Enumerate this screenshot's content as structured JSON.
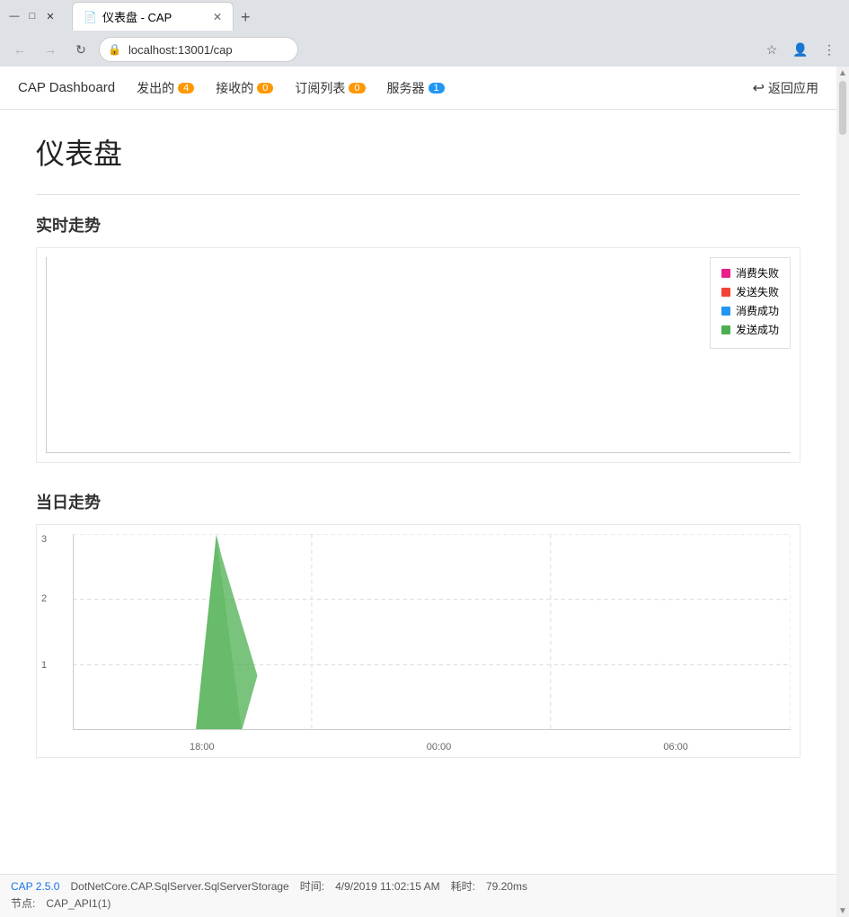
{
  "browser": {
    "tab_title": "仪表盘 - CAP",
    "tab_icon": "📄",
    "url": "localhost:13001/cap",
    "new_tab_symbol": "+",
    "nav": {
      "back_disabled": false,
      "forward_disabled": false
    }
  },
  "nav": {
    "brand": "CAP Dashboard",
    "links": [
      {
        "label": "发出的",
        "badge": "4",
        "badge_color": "orange"
      },
      {
        "label": "接收的",
        "badge": "0",
        "badge_color": "orange"
      },
      {
        "label": "订阅列表",
        "badge": "0",
        "badge_color": "orange"
      },
      {
        "label": "服务器",
        "badge": "1",
        "badge_color": "blue"
      }
    ],
    "return_label": "返回应用"
  },
  "page": {
    "title": "仪表盘",
    "realtime_section": "实时走势",
    "daily_section": "当日走势"
  },
  "realtime_chart": {
    "legend": [
      {
        "label": "消费失败",
        "color": "#e91e8c"
      },
      {
        "label": "发送失败",
        "color": "#f44336"
      },
      {
        "label": "消费成功",
        "color": "#2196f3"
      },
      {
        "label": "发送成功",
        "color": "#4caf50"
      }
    ]
  },
  "daily_chart": {
    "y_labels": [
      "3",
      "2",
      "1"
    ],
    "x_labels": [
      "18:00",
      "00:00",
      "06:00"
    ],
    "peak_value": 3,
    "color": "#4caf50"
  },
  "status_bar": {
    "version": "CAP 2.5.0",
    "storage": "DotNetCore.CAP.SqlServer.SqlServerStorage",
    "time_label": "时间:",
    "time_value": "4/9/2019 11:02:15 AM",
    "duration_label": "耗时:",
    "duration_value": "79.20ms",
    "node_label": "节点:",
    "node_value": "CAP_API1(1)"
  }
}
